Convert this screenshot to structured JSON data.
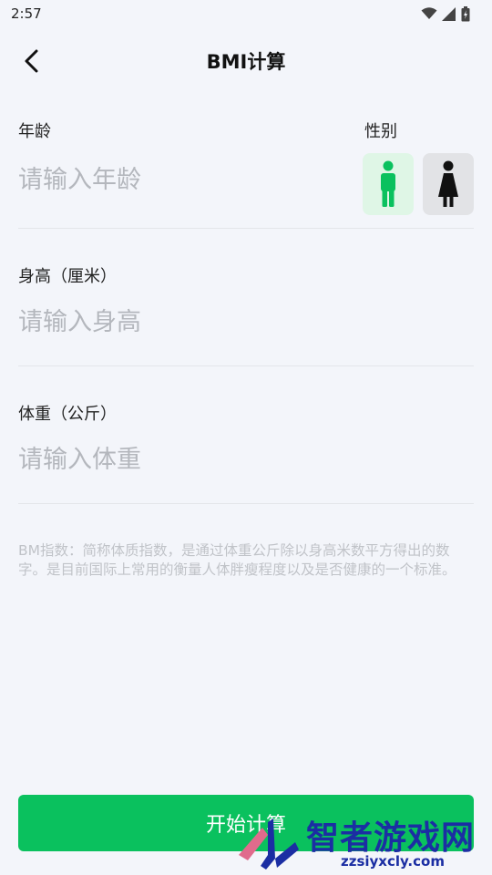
{
  "status_bar": {
    "time": "2:57",
    "icons": [
      "wifi-icon",
      "signal-icon",
      "battery-icon"
    ]
  },
  "app_bar": {
    "back_icon": "chevron-left-icon",
    "title": "BMI计算"
  },
  "form": {
    "age": {
      "label": "年龄",
      "placeholder": "请输入年龄",
      "value": ""
    },
    "gender": {
      "label": "性别",
      "options": [
        {
          "name": "male",
          "icon": "male-icon",
          "selected": true
        },
        {
          "name": "female",
          "icon": "female-icon",
          "selected": false
        }
      ]
    },
    "height": {
      "label": "身高（厘米）",
      "placeholder": "请输入身高",
      "value": ""
    },
    "weight": {
      "label": "体重（公斤）",
      "placeholder": "请输入体重",
      "value": ""
    }
  },
  "description": "BM指数：简称体质指数，是通过体重公斤除以身高米数平方得出的数字。是目前国际上常用的衡量人体胖瘦程度以及是否健康的一个标准。",
  "start_button": {
    "label": "开始计算"
  },
  "watermark": {
    "text": "智者游戏网",
    "url": "zzsiyxcly.com"
  },
  "colors": {
    "background": "#f3f5fa",
    "accent": "#0ac15e",
    "male_bg": "#dff6e6",
    "female_bg": "#e2e3e6",
    "placeholder": "#b4b7bd",
    "watermark": "#1b2ea3"
  }
}
